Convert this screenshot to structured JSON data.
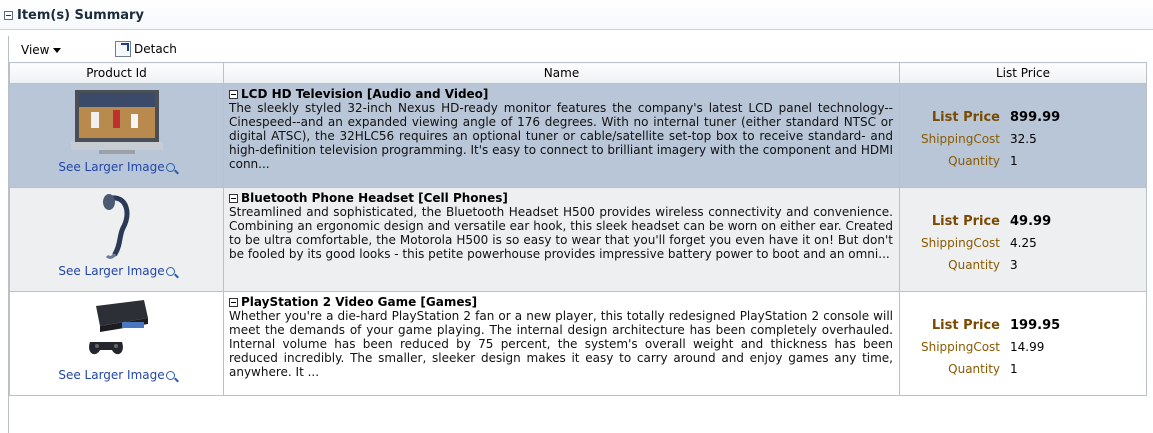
{
  "section": {
    "title": "Item(s) Summary"
  },
  "toolbar": {
    "view_label": "View",
    "detach_label": "Detach"
  },
  "columns": {
    "product_id": "Product Id",
    "name": "Name",
    "list_price": "List Price"
  },
  "labels": {
    "see_larger": "See Larger Image",
    "list_price": "List Price",
    "shipping_cost": "ShippingCost",
    "quantity": "Quantity"
  },
  "items": [
    {
      "title": "LCD HD Television [Audio and Video]",
      "description": "The sleekly styled 32-inch Nexus HD-ready monitor features the company's latest LCD panel technology--Cinespeed--and an expanded viewing angle of 176 degrees. With no internal tuner (either standard NTSC or digital ATSC), the 32HLC56 requires an optional tuner or cable/satellite set-top box to receive standard- and high-definition television programming. It's easy to connect to brilliant imagery with the component and HDMI conn...",
      "list_price": "899.99",
      "shipping_cost": "32.5",
      "quantity": "1"
    },
    {
      "title": "Bluetooth Phone Headset [Cell Phones]",
      "description": "Streamlined and sophisticated, the Bluetooth Headset H500 provides wireless connectivity and convenience. Combining an ergonomic design and versatile ear hook, this sleek headset can be worn on either ear. Created to be ultra comfortable, the Motorola H500 is so easy to wear that you'll forget you even have it on! But don't be fooled by its good looks - this petite powerhouse provides impressive battery power to boot and an omni...",
      "list_price": "49.99",
      "shipping_cost": "4.25",
      "quantity": "3"
    },
    {
      "title": "PlayStation 2 Video Game [Games]",
      "description": "Whether you're a die-hard PlayStation 2 fan or a new player, this totally redesigned PlayStation 2 console will meet the demands of your game playing. The internal design architecture has been completely overhauled. Internal volume has been reduced by 75 percent, the system's overall weight and thickness has been reduced incredibly. The smaller, sleeker design makes it easy to carry around and enjoy games any time, anywhere. It ...",
      "list_price": "199.95",
      "shipping_cost": "14.99",
      "quantity": "1"
    }
  ]
}
